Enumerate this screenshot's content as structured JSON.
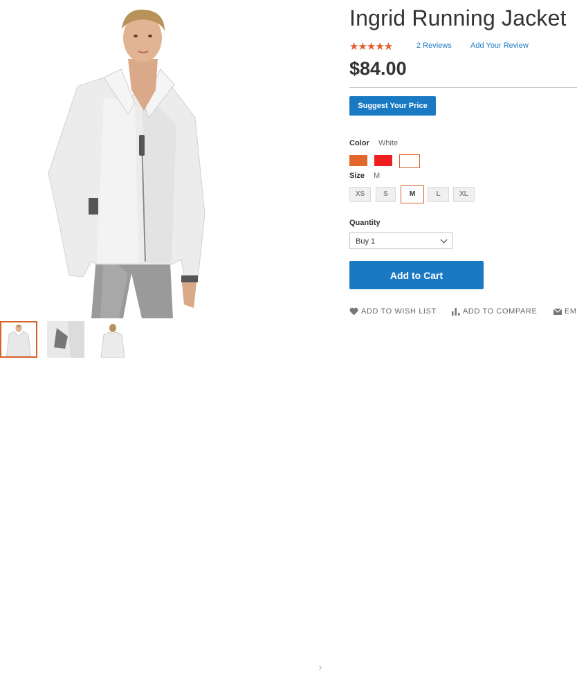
{
  "product": {
    "title": "Ingrid Running Jacket",
    "rating_fraction": 0.9,
    "stars_glyphs": "★★★★★",
    "reviews_link": "2 Reviews",
    "add_review_link": "Add Your Review",
    "price": "$84.00"
  },
  "buttons": {
    "suggest_price": "Suggest Your Price",
    "add_to_cart": "Add to Cart"
  },
  "options": {
    "color": {
      "label": "Color",
      "selected": "White",
      "swatches": [
        {
          "name": "Orange",
          "hex": "#e2672a"
        },
        {
          "name": "Red",
          "hex": "#f01f1f"
        },
        {
          "name": "White",
          "hex": "#ffffff"
        }
      ]
    },
    "size": {
      "label": "Size",
      "selected": "M",
      "values": [
        "XS",
        "S",
        "M",
        "L",
        "XL"
      ]
    }
  },
  "quantity": {
    "label": "Quantity",
    "value": "Buy 1"
  },
  "actions": {
    "wish_list": "ADD TO WISH LIST",
    "compare": "ADD TO COMPARE",
    "email": "EM"
  },
  "gallery": {
    "next_glyph": "›",
    "active_thumb": 0,
    "thumb_count": 3
  },
  "colors": {
    "accent_blue": "#1979c3",
    "star_orange": "#ea5a2a",
    "selected_border": "#d9612b"
  }
}
